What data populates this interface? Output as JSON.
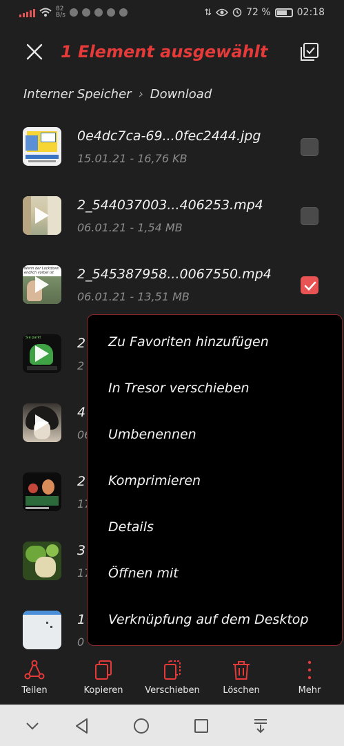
{
  "status_bar": {
    "network_speed_value": "82",
    "network_speed_unit": "B/s",
    "battery": "72 %",
    "battery_level": 0.72,
    "time": "02:18"
  },
  "app_bar": {
    "title": "1 Element ausgewählt",
    "close_icon": "close-icon",
    "select_all_icon": "select-all-icon"
  },
  "breadcrumb": {
    "items": [
      "Interner Speicher",
      "Download"
    ]
  },
  "colors": {
    "accent": "#e53a3a",
    "background": "#1f1f1f",
    "menu_background": "#000000",
    "checkbox_checked": "#e85454"
  },
  "files": [
    {
      "name": "0e4dc7ca-69...0fec2444.jpg",
      "meta": "15.01.21 - 16,76 KB",
      "type": "image",
      "selected": false
    },
    {
      "name": "2_544037003...406253.mp4",
      "meta": "06.01.21 - 1,54 MB",
      "type": "video",
      "selected": false
    },
    {
      "name": "2_545387958...0067550.mp4",
      "meta": "06.01.21 - 13,51 MB",
      "type": "video",
      "selected": true,
      "thumb_text": "Wenn der Lockdown endlich vorbei ist"
    },
    {
      "name": "2",
      "meta": "2",
      "type": "video",
      "selected": false,
      "thumb_text": "Sie parkt"
    },
    {
      "name": "4",
      "meta": "06",
      "type": "video",
      "selected": false
    },
    {
      "name": "2",
      "meta": "17",
      "type": "image",
      "selected": false
    },
    {
      "name": "3",
      "meta": "17",
      "type": "image",
      "selected": false
    },
    {
      "name": "1",
      "meta": "0",
      "type": "image",
      "selected": false
    }
  ],
  "context_menu": {
    "items": [
      "Zu Favoriten hinzufügen",
      "In Tresor verschieben",
      "Umbenennen",
      "Komprimieren",
      "Details",
      "Öffnen mit",
      "Verknüpfung auf dem Desktop"
    ]
  },
  "action_bar": {
    "items": [
      {
        "label": "Teilen",
        "icon": "share-icon"
      },
      {
        "label": "Kopieren",
        "icon": "copy-icon"
      },
      {
        "label": "Verschieben",
        "icon": "move-icon"
      },
      {
        "label": "Löschen",
        "icon": "trash-icon"
      },
      {
        "label": "Mehr",
        "icon": "more-icon"
      }
    ]
  },
  "nav_bar": {
    "items": [
      "collapse-icon",
      "back-icon",
      "home-icon",
      "recents-icon",
      "notification-pull-icon"
    ]
  }
}
